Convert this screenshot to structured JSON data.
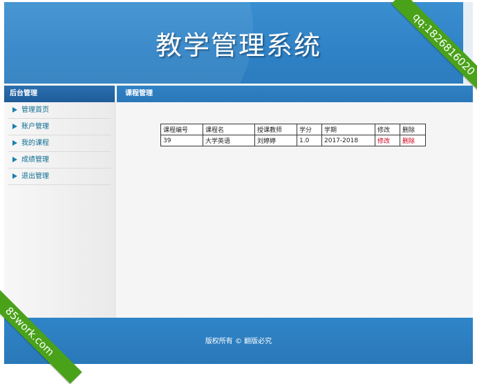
{
  "header": {
    "title": "教学管理系统"
  },
  "sidebar": {
    "title": "后台管理",
    "items": [
      {
        "label": "管理首页"
      },
      {
        "label": "账户管理"
      },
      {
        "label": "我的课程"
      },
      {
        "label": "成绩管理"
      },
      {
        "label": "退出管理"
      }
    ]
  },
  "main": {
    "title": "课程管理",
    "table": {
      "headers": [
        "课程编号",
        "课程名",
        "授课教师",
        "学分",
        "学期",
        "修改",
        "删除"
      ],
      "rows": [
        {
          "id": "39",
          "name": "大学英语",
          "teacher": "刘婷婷",
          "credit": "1.0",
          "term": "2017-2018",
          "edit": "修改",
          "delete": "删除"
        }
      ]
    }
  },
  "footer": {
    "copyright": "版权所有 © 翻版必究"
  },
  "watermarks": {
    "top_right": "qq:1826816020",
    "bottom_left": "85work.com"
  },
  "colors": {
    "header_blue": "#2f82c6",
    "link_red": "#d0021b",
    "ribbon_green": "#4aa21a"
  }
}
